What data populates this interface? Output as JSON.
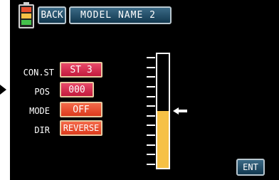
{
  "colors": {
    "screen_bg": "#000000",
    "nav_button": "#1f4c66",
    "value_red": "#d4264a",
    "value_orange": "#e8502f",
    "gauge_fill": "#f6c146"
  },
  "battery": {
    "icon": "battery-icon",
    "segment_colors": [
      "#44c04a",
      "#f6c146",
      "#e8502f"
    ]
  },
  "header": {
    "back_label": "BACK",
    "model_name": "MODEL NAME  2"
  },
  "settings": [
    {
      "label": "CON.ST",
      "value": "ST 3",
      "style": "red"
    },
    {
      "label": "POS",
      "value": "000",
      "style": "red"
    },
    {
      "label": "MODE",
      "value": "OFF",
      "style": "orange"
    },
    {
      "label": "DIR",
      "value": "REVERSE",
      "style": "orange"
    }
  ],
  "gauge": {
    "level_fraction": 0.5,
    "tick_count": 12,
    "indicator": "arrow-left-icon"
  },
  "footer": {
    "ent_label": "ENT"
  }
}
